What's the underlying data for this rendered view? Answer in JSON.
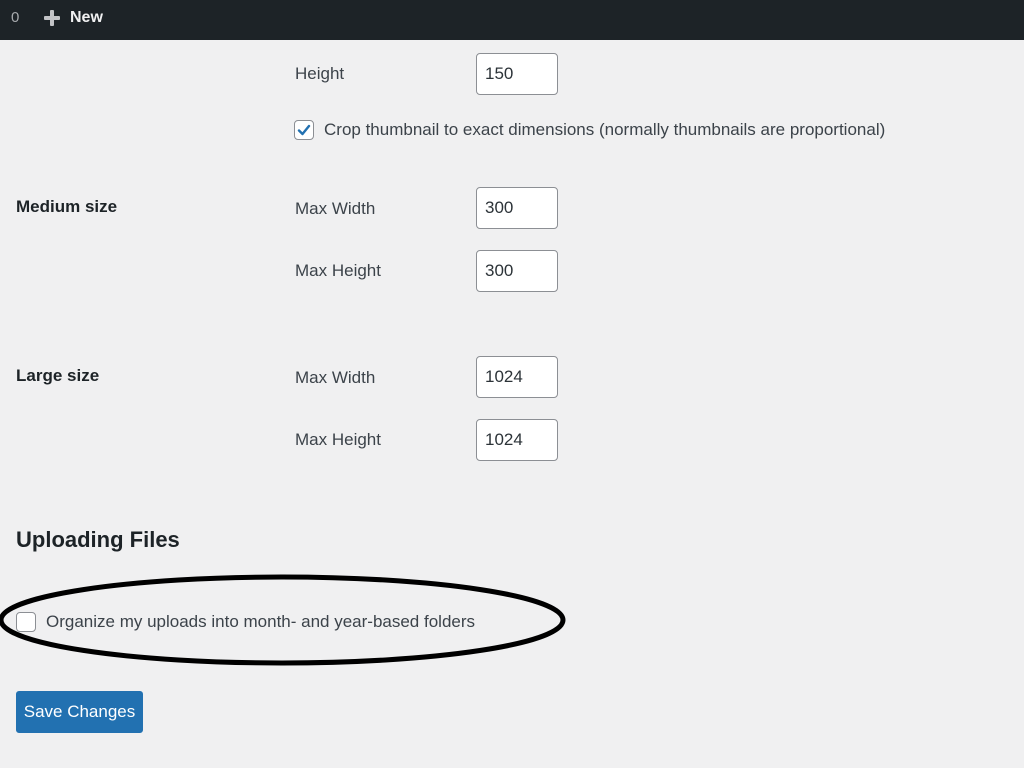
{
  "admin_bar": {
    "comment_count": "0",
    "new_label": "New",
    "new_icon": "plus-icon"
  },
  "thumbnail": {
    "height_label": "Height",
    "height_value": "150",
    "crop_checked": true,
    "crop_label": "Crop thumbnail to exact dimensions (normally thumbnails are proportional)"
  },
  "medium": {
    "label": "Medium size",
    "max_width_label": "Max Width",
    "max_width_value": "300",
    "max_height_label": "Max Height",
    "max_height_value": "300"
  },
  "large": {
    "label": "Large size",
    "max_width_label": "Max Width",
    "max_width_value": "1024",
    "max_height_label": "Max Height",
    "max_height_value": "1024"
  },
  "uploading": {
    "title": "Uploading Files",
    "organize_checked": false,
    "organize_label": "Organize my uploads into month- and year-based folders"
  },
  "save_button_label": "Save Changes",
  "colors": {
    "accent": "#2271b1",
    "admin_bar": "#1d2327",
    "background": "#f0f0f1",
    "annotation": "#000000"
  }
}
